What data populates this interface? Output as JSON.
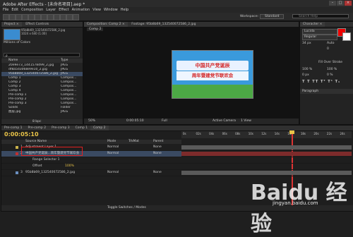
{
  "window": {
    "title": "Adobe After Effects - [未命名项目].aep *",
    "min": "–",
    "max": "□",
    "close": "×"
  },
  "menu": [
    "File",
    "Edit",
    "Composition",
    "Layer",
    "Effect",
    "Animation",
    "View",
    "Window",
    "Help"
  ],
  "toolbar": {
    "workspace_label": "Workspace:",
    "workspace_value": "Standard",
    "search_placeholder": "Search Help"
  },
  "project": {
    "tab": "Project ×",
    "effect_controls_tab": "Effect Controls",
    "thumb_title": "95b8b69_132540072586_2.jpg",
    "thumb_info": "1024 x 640 (1.00)",
    "thumb_desc": "Millions of Colors",
    "search_placeholder": "ρ",
    "col_name": "Name",
    "col_type": "Type",
    "items": [
      {
        "name": "20e9e73_1441578499_2.jpg",
        "type": "JPEG"
      },
      {
        "name": "df8a5d3068e9e10_2.jpg",
        "type": "JPEG"
      },
      {
        "name": "95b8b69_132540072586_2.jpg",
        "type": "JPEG",
        "selected": true
      },
      {
        "name": "Comp 1",
        "type": "Compos..."
      },
      {
        "name": "Comp 2",
        "type": "Compos..."
      },
      {
        "name": "Comp 3",
        "type": "Compos..."
      },
      {
        "name": "Comp 4",
        "type": "Compos..."
      },
      {
        "name": "Pre-comp 1",
        "type": "Compos..."
      },
      {
        "name": "Pre-comp 2",
        "type": "Compos..."
      },
      {
        "name": "Pre-comp 3",
        "type": "Compos..."
      },
      {
        "name": "Solids",
        "type": "Folder"
      },
      {
        "name": "图层.jpg",
        "type": "JPEG"
      }
    ],
    "bpc": "8 bpc"
  },
  "viewer": {
    "tab": "Composition: Comp 2 ×",
    "tab2": "Footage: 95b8b69_132540072586_2.jpg",
    "comp_name": "Comp 2",
    "zoom": "50%",
    "time": "0:00:05:10",
    "resolution": "Full",
    "camera": "Active Camera",
    "views": "1 View",
    "comp_line1": "中国共产党诞辰",
    "comp_line2": "周年暨建党节联欢会"
  },
  "character_panel": {
    "tab": "Character ×",
    "font": "Lucida",
    "style": "Regular",
    "size": "34 px",
    "leading": "Auto",
    "tracking": "0",
    "stroke": "Fill Over Stroke",
    "scale_v": "100 %",
    "scale_h": "100 %",
    "baseline": "0 px",
    "tsume": "0 %",
    "bottom_tab": "Paragraph",
    "search_label": "Search Help"
  },
  "timeline": {
    "tabs": [
      "Pre-comp 1",
      "Pre-comp 2",
      "Pre-comp 3",
      "Comp 1",
      "Comp 2"
    ],
    "active_tab_index": 4,
    "timecode": "0:00:05:10",
    "col_source": "Source Name",
    "col_mode": "Mode",
    "col_trkmat": "TrkMat",
    "col_parent": "Parent",
    "layers": [
      {
        "num": "1",
        "name": "Adjustment Layer 1",
        "mode": "Normal",
        "parent": "None",
        "color": "#c9b24a"
      },
      {
        "num": "2",
        "name": "中国共产党诞辰...周年暨建党节联欢会",
        "mode": "Normal",
        "parent": "None",
        "color": "#c23030",
        "selected": true
      },
      {
        "num": "",
        "name": "Range Selector 1",
        "mode": "",
        "parent": "",
        "color": ""
      },
      {
        "num": "",
        "name": "Offset",
        "mode": "",
        "parent": "",
        "color": "",
        "value": "100%"
      },
      {
        "num": "3",
        "name": "95b8b69_132540072586_2.jpg",
        "mode": "Normal",
        "parent": "None",
        "color": "#6a8fbf"
      }
    ],
    "ruler_ticks": [
      "0s",
      "02s",
      "04s",
      "06s",
      "08s",
      "10s",
      "12s",
      "14s",
      "16s",
      "18s",
      "20s",
      "22s",
      "24s"
    ],
    "footer": "Toggle Switches / Modes"
  },
  "watermark": {
    "main": "Baidu 经验",
    "url": "jingyan.baidu.com"
  }
}
